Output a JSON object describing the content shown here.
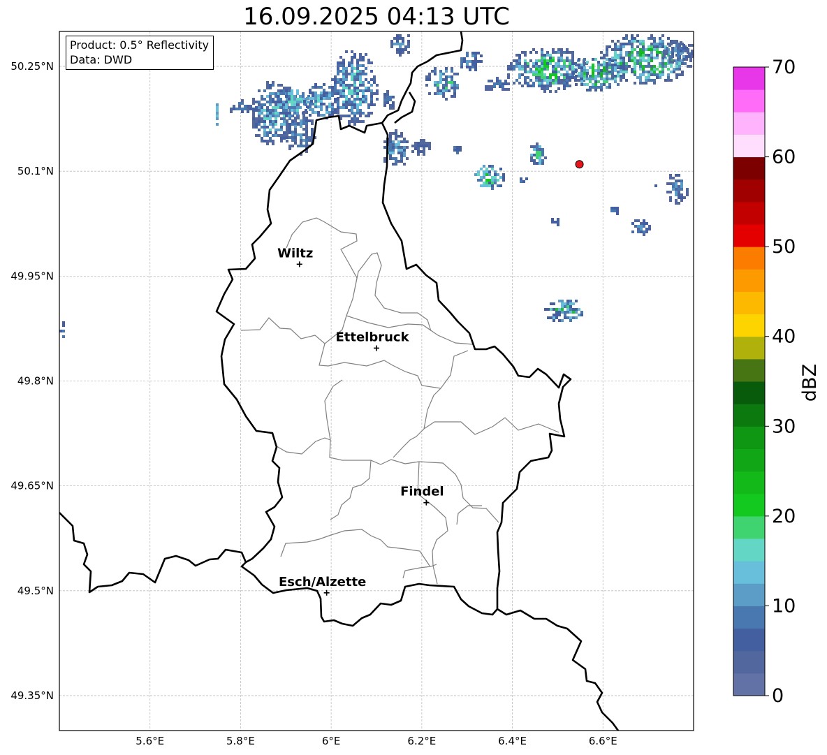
{
  "title": "16.09.2025 04:13 UTC",
  "info": {
    "product": "Product: 0.5° Reflectivity",
    "source": "Data: DWD"
  },
  "axes": {
    "lon_range": [
      5.4,
      6.8
    ],
    "lat_range": [
      49.3,
      50.3
    ],
    "x_ticks": [
      {
        "value": 5.6,
        "label": "5.6°E"
      },
      {
        "value": 5.8,
        "label": "5.8°E"
      },
      {
        "value": 6.0,
        "label": "6°E"
      },
      {
        "value": 6.2,
        "label": "6.2°E"
      },
      {
        "value": 6.4,
        "label": "6.4°E"
      },
      {
        "value": 6.6,
        "label": "6.6°E"
      }
    ],
    "y_ticks": [
      {
        "value": 50.25,
        "label": "50.25°N"
      },
      {
        "value": 50.1,
        "label": "50.1°N"
      },
      {
        "value": 49.95,
        "label": "49.95°N"
      },
      {
        "value": 49.8,
        "label": "49.8°N"
      },
      {
        "value": 49.65,
        "label": "49.65°N"
      },
      {
        "value": 49.5,
        "label": "49.5°N"
      },
      {
        "value": 49.35,
        "label": "49.35°N"
      }
    ],
    "grid": true
  },
  "cities": [
    {
      "name": "Wiltz",
      "lon": 5.93,
      "lat": 49.967
    },
    {
      "name": "Ettelbruck",
      "lon": 6.1,
      "lat": 49.847
    },
    {
      "name": "Findel",
      "lon": 6.21,
      "lat": 49.626
    },
    {
      "name": "Esch/Alzette",
      "lon": 5.99,
      "lat": 49.497
    }
  ],
  "radar_site": {
    "lon": 6.548,
    "lat": 50.11,
    "color": "#e8141b"
  },
  "colorbar": {
    "label": "dBZ",
    "min": 0,
    "max": 70,
    "step": 2.5,
    "ticks": [
      {
        "value": 0,
        "label": "0"
      },
      {
        "value": 10,
        "label": "10"
      },
      {
        "value": 20,
        "label": "20"
      },
      {
        "value": 30,
        "label": "30"
      },
      {
        "value": 40,
        "label": "40"
      },
      {
        "value": 50,
        "label": "50"
      },
      {
        "value": 60,
        "label": "60"
      },
      {
        "value": 70,
        "label": "70"
      }
    ],
    "colors": [
      "#6272a6",
      "#53679f",
      "#445f9f",
      "#4977b0",
      "#5b9dc6",
      "#67bfdb",
      "#63d6c5",
      "#3fd470",
      "#13c91f",
      "#13b819",
      "#11a615",
      "#0f9612",
      "#0c790f",
      "#075b0b",
      "#477513",
      "#b0b10a",
      "#fdd400",
      "#fdb800",
      "#fd9a00",
      "#fc7c00",
      "#e50000",
      "#c20000",
      "#a00000",
      "#7c0000",
      "#ffdefd",
      "#ffb3fd",
      "#ff6cf7",
      "#e837e8"
    ]
  }
}
